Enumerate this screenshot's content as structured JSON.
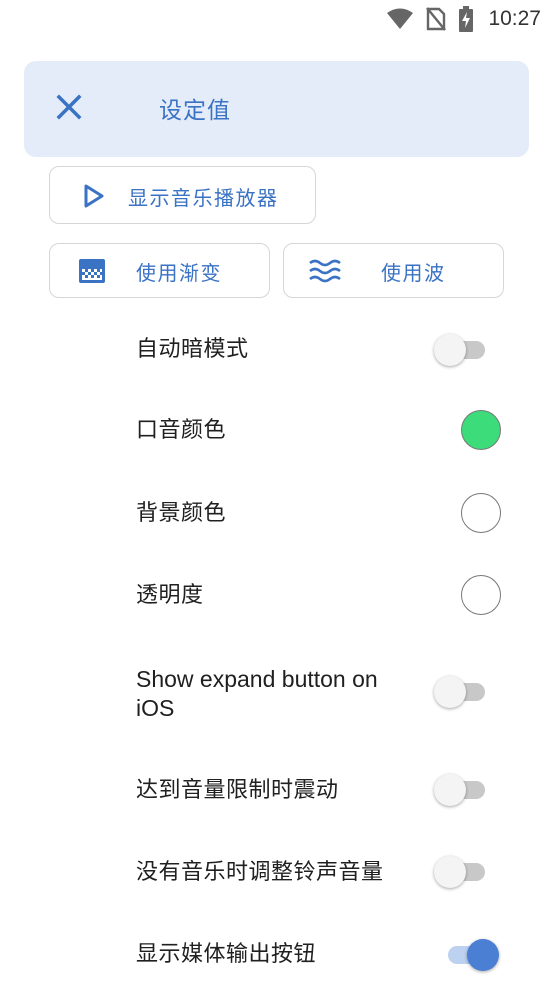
{
  "status_bar": {
    "time": "10:27",
    "icons": [
      "wifi-icon",
      "no-sim-icon",
      "battery-charging-icon"
    ]
  },
  "header": {
    "close_icon": "close-icon",
    "title": "设定值"
  },
  "buttons": {
    "player": {
      "label": "显示音乐播放器",
      "icon": "play-icon"
    },
    "gradient": {
      "label": "使用渐变",
      "icon": "gradient-icon"
    },
    "wave": {
      "label": "使用波",
      "icon": "wave-icon"
    }
  },
  "settings": [
    {
      "label": "自动暗模式",
      "control": "toggle",
      "on": false
    },
    {
      "label": "口音颜色",
      "control": "color",
      "color": "#3ddc7a"
    },
    {
      "label": "背景颜色",
      "control": "color",
      "color": "#ffffff"
    },
    {
      "label": "透明度",
      "control": "color",
      "color": "#ffffff"
    },
    {
      "label": "Show expand button on iOS",
      "control": "toggle",
      "on": false
    },
    {
      "label": "达到音量限制时震动",
      "control": "toggle",
      "on": false
    },
    {
      "label": "没有音乐时调整铃声音量",
      "control": "toggle",
      "on": false
    },
    {
      "label": "显示媒体输出按钮",
      "control": "toggle",
      "on": true
    }
  ],
  "colors": {
    "accent": "#3a72c4",
    "header_bg": "#e3ecf8",
    "toggle_on": "#4a7fd3"
  }
}
